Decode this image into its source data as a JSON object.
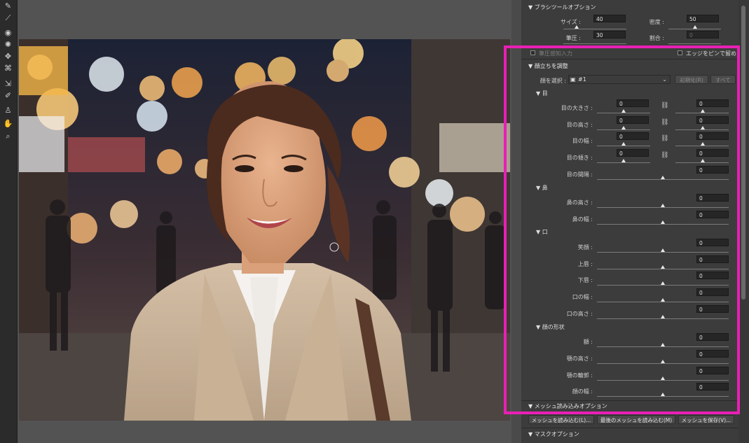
{
  "toolbar": {
    "tools": [
      {
        "icon": "forward-warp-icon",
        "glyph": "✎"
      },
      {
        "icon": "reconstruct-icon",
        "glyph": "⟋"
      },
      {
        "icon": "smooth-icon",
        "glyph": "◉"
      },
      {
        "icon": "twirl-icon",
        "glyph": "✺"
      },
      {
        "icon": "pucker-icon",
        "glyph": "✥"
      },
      {
        "icon": "bloat-icon",
        "glyph": "⌘"
      },
      {
        "icon": "push-left-icon",
        "glyph": "⇲"
      },
      {
        "icon": "freeze-mask-icon",
        "glyph": "✐"
      },
      {
        "icon": "face-tool-icon",
        "glyph": "♙"
      },
      {
        "icon": "hand-icon",
        "glyph": "✋"
      },
      {
        "icon": "zoom-icon",
        "glyph": "⌕"
      }
    ]
  },
  "brush_options": {
    "title": "ブラシツールオプション",
    "size_label": "サイズ :",
    "size_value": "40",
    "density_label": "密度 :",
    "density_value": "50",
    "pressure_label": "筆圧 :",
    "pressure_value": "30",
    "rate_label": "割合 :",
    "rate_value": "0",
    "stylus_label": "筆圧感知入力",
    "pin_edges_label": "エッジをピンで留める"
  },
  "face_aware": {
    "title": "顔立ちを調整",
    "select_face_label": "顔を選択 :",
    "select_face_value": "#1",
    "reset_button": "初期化(R)",
    "all_button": "すべて",
    "eyes": {
      "title": "目",
      "rows": [
        {
          "label": "目の大きさ :",
          "left": "0",
          "right": "0"
        },
        {
          "label": "目の高さ :",
          "left": "0",
          "right": "0"
        },
        {
          "label": "目の幅 :",
          "left": "0",
          "right": "0"
        },
        {
          "label": "目の傾き :",
          "left": "0",
          "right": "0"
        }
      ],
      "distance": {
        "label": "目の間隔 :",
        "value": "0"
      }
    },
    "nose": {
      "title": "鼻",
      "rows": [
        {
          "label": "鼻の高さ :",
          "value": "0"
        },
        {
          "label": "鼻の幅 :",
          "value": "0"
        }
      ]
    },
    "mouth": {
      "title": "口",
      "rows": [
        {
          "label": "笑顔 :",
          "value": "0"
        },
        {
          "label": "上唇 :",
          "value": "0"
        },
        {
          "label": "下唇 :",
          "value": "0"
        },
        {
          "label": "口の幅 :",
          "value": "0"
        },
        {
          "label": "口の高さ :",
          "value": "0"
        }
      ]
    },
    "face_shape": {
      "title": "顔の形状",
      "rows": [
        {
          "label": "額 :",
          "value": "0"
        },
        {
          "label": "顎の高さ :",
          "value": "0"
        },
        {
          "label": "顎の輪郭 :",
          "value": "0"
        },
        {
          "label": "顔の幅 :",
          "value": "0"
        }
      ]
    }
  },
  "mesh": {
    "title": "メッシュ読み込みオプション",
    "load_button": "メッシュを読み込む(L)...",
    "load_last_button": "最後のメッシュを読み込む(M)",
    "save_button": "メッシュを保存(V)..."
  },
  "mask": {
    "title": "マスクオプション"
  },
  "colors": {
    "highlight": "#e81fb5",
    "panel": "#3c3c3c"
  }
}
